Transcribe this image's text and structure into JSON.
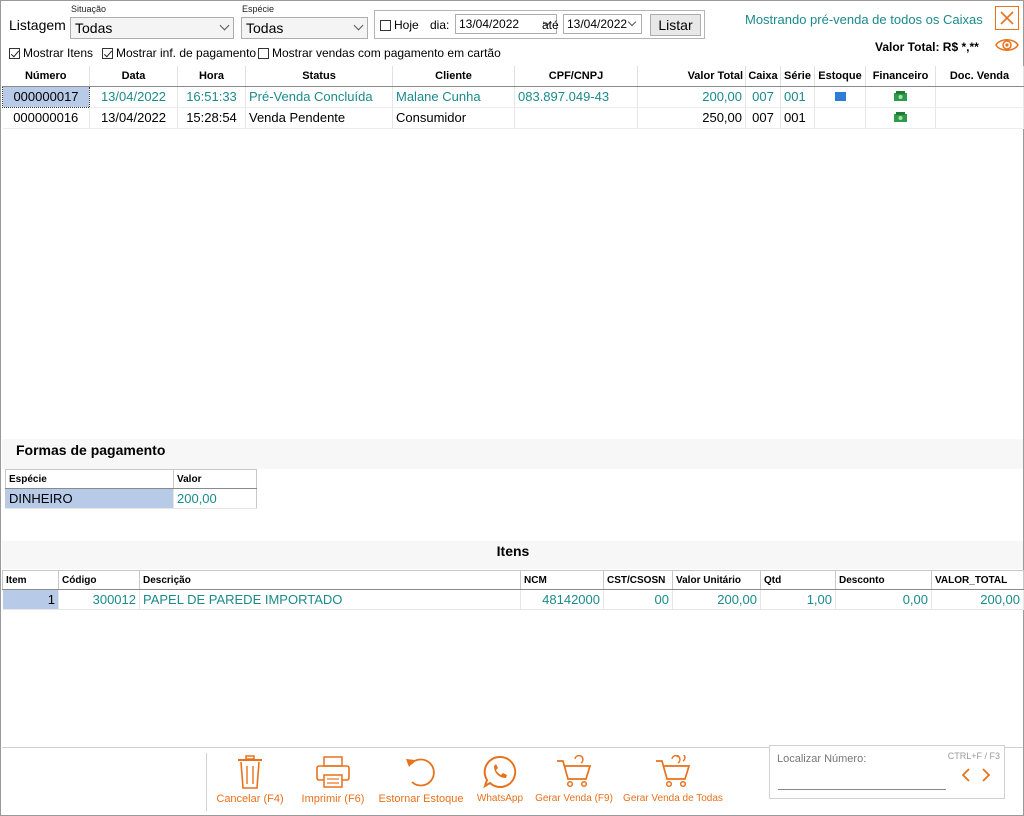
{
  "filters": {
    "listagem_label": "Listagem",
    "situacao_label": "Situação",
    "situacao_value": "Todas",
    "especie_label": "Espécie",
    "especie_value": "Todas",
    "hoje_label": "Hoje",
    "hoje_checked": false,
    "dia_label": "dia:",
    "dia_value": "13/04/2022",
    "ate_label": "até",
    "ate_value": "13/04/2022",
    "listar_label": "Listar",
    "mostrar_itens_label": "Mostrar Itens",
    "mostrar_itens_checked": true,
    "mostrar_pagamento_label": "Mostrar inf. de pagamento",
    "mostrar_pagamento_checked": true,
    "mostrar_cartao_label": "Mostrar vendas com pagamento em cartão",
    "mostrar_cartao_checked": false
  },
  "header": {
    "info_text": "Mostrando pré-venda de todos os Caixas",
    "valor_total_label": "Valor Total: R$ *,**",
    "close_icon": "close-icon",
    "eye_icon": "eye-icon"
  },
  "sales_table": {
    "columns": [
      "Número",
      "Data",
      "Hora",
      "Status",
      "Cliente",
      "CPF/CNPJ",
      "Valor Total",
      "Caixa",
      "Série",
      "Estoque",
      "Financeiro",
      "Doc. Venda"
    ],
    "rows": [
      {
        "numero": "000000017",
        "data": "13/04/2022",
        "hora": "16:51:33",
        "status": "Pré-Venda Concluída",
        "cliente": "Malane Cunha",
        "cpf": "083.897.049-43",
        "valor_total": "200,00",
        "caixa": "007",
        "serie": "001",
        "estoque_icon": "stock-flag-icon",
        "financeiro_icon": "money-icon",
        "doc_venda": "",
        "highlight": true
      },
      {
        "numero": "000000016",
        "data": "13/04/2022",
        "hora": "15:28:54",
        "status": "Venda Pendente",
        "cliente": "Consumidor",
        "cpf": "",
        "valor_total": "250,00",
        "caixa": "007",
        "serie": "001",
        "estoque_icon": "",
        "financeiro_icon": "money-icon",
        "doc_venda": "",
        "highlight": false
      }
    ]
  },
  "payments": {
    "title": "Formas de pagamento",
    "columns": [
      "Espécie",
      "Valor"
    ],
    "rows": [
      {
        "especie": "DINHEIRO",
        "valor": "200,00"
      }
    ]
  },
  "items": {
    "title": "Itens",
    "columns": [
      "Item",
      "Código",
      "Descrição",
      "NCM",
      "CST/CSOSN",
      "Valor Unitário",
      "Qtd",
      "Desconto",
      "VALOR_TOTAL"
    ],
    "rows": [
      {
        "item": "1",
        "codigo": "300012",
        "descricao": "PAPEL DE PAREDE IMPORTADO",
        "ncm": "48142000",
        "cst": "00",
        "valor_unitario": "200,00",
        "qtd": "1,00",
        "desconto": "0,00",
        "valor_total": "200,00"
      }
    ]
  },
  "toolbar": {
    "cancelar": "Cancelar (F4)",
    "imprimir": "Imprimir (F6)",
    "estornar": "Estornar Estoque",
    "whatsapp": "WhatsApp",
    "gerar_venda": "Gerar Venda (F9)",
    "gerar_todas": "Gerar Venda de Todas"
  },
  "search": {
    "label": "Localizar Número:",
    "shortcut": "CTRL+F / F3",
    "value": ""
  },
  "colors": {
    "accent_orange": "#e8711c",
    "teal_text": "#1b8a8a",
    "selection_blue": "#b7cbe9"
  }
}
